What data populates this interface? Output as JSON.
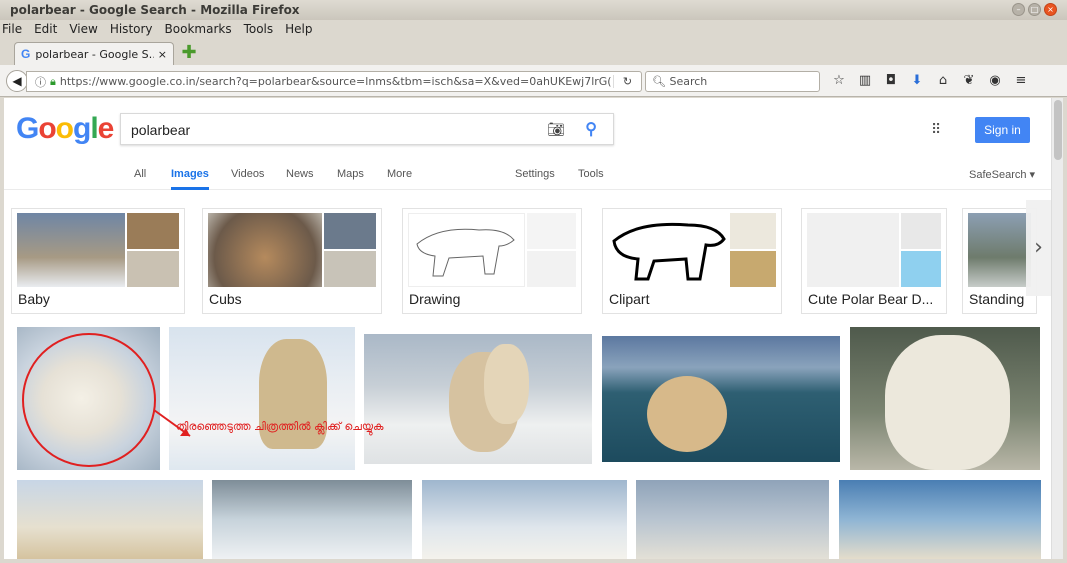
{
  "window": {
    "title": "polarbear - Google Search - Mozilla Firefox"
  },
  "menu": [
    "File",
    "Edit",
    "View",
    "History",
    "Bookmarks",
    "Tools",
    "Help"
  ],
  "tab": {
    "label": "polarbear - Google S…",
    "close": "×",
    "favicon": "G"
  },
  "nav": {
    "url": "https://www.google.co.in/search?q=polarbear&source=lnms&tbm=isch&sa=X&ved=0ahUKEwj7lrG(",
    "search_placeholder": "Search"
  },
  "google": {
    "query": "polarbear",
    "signin": "Sign in",
    "tabs": [
      "All",
      "Images",
      "Videos",
      "News",
      "Maps",
      "More",
      "Settings",
      "Tools"
    ],
    "active_tab": "Images",
    "safesearch": "SafeSearch ▾"
  },
  "chips": [
    {
      "label": "Baby"
    },
    {
      "label": "Cubs"
    },
    {
      "label": "Drawing"
    },
    {
      "label": "Clipart"
    },
    {
      "label": "Cute Polar Bear D..."
    },
    {
      "label": "Standing"
    }
  ],
  "annotation": "തിരഞ്ഞെടുത്ത ചിത്രത്തിൽ ക്ലിക്ക് ചെയ്യുക",
  "colors": {
    "accent": "#4285f4",
    "annotation": "#e02020"
  }
}
